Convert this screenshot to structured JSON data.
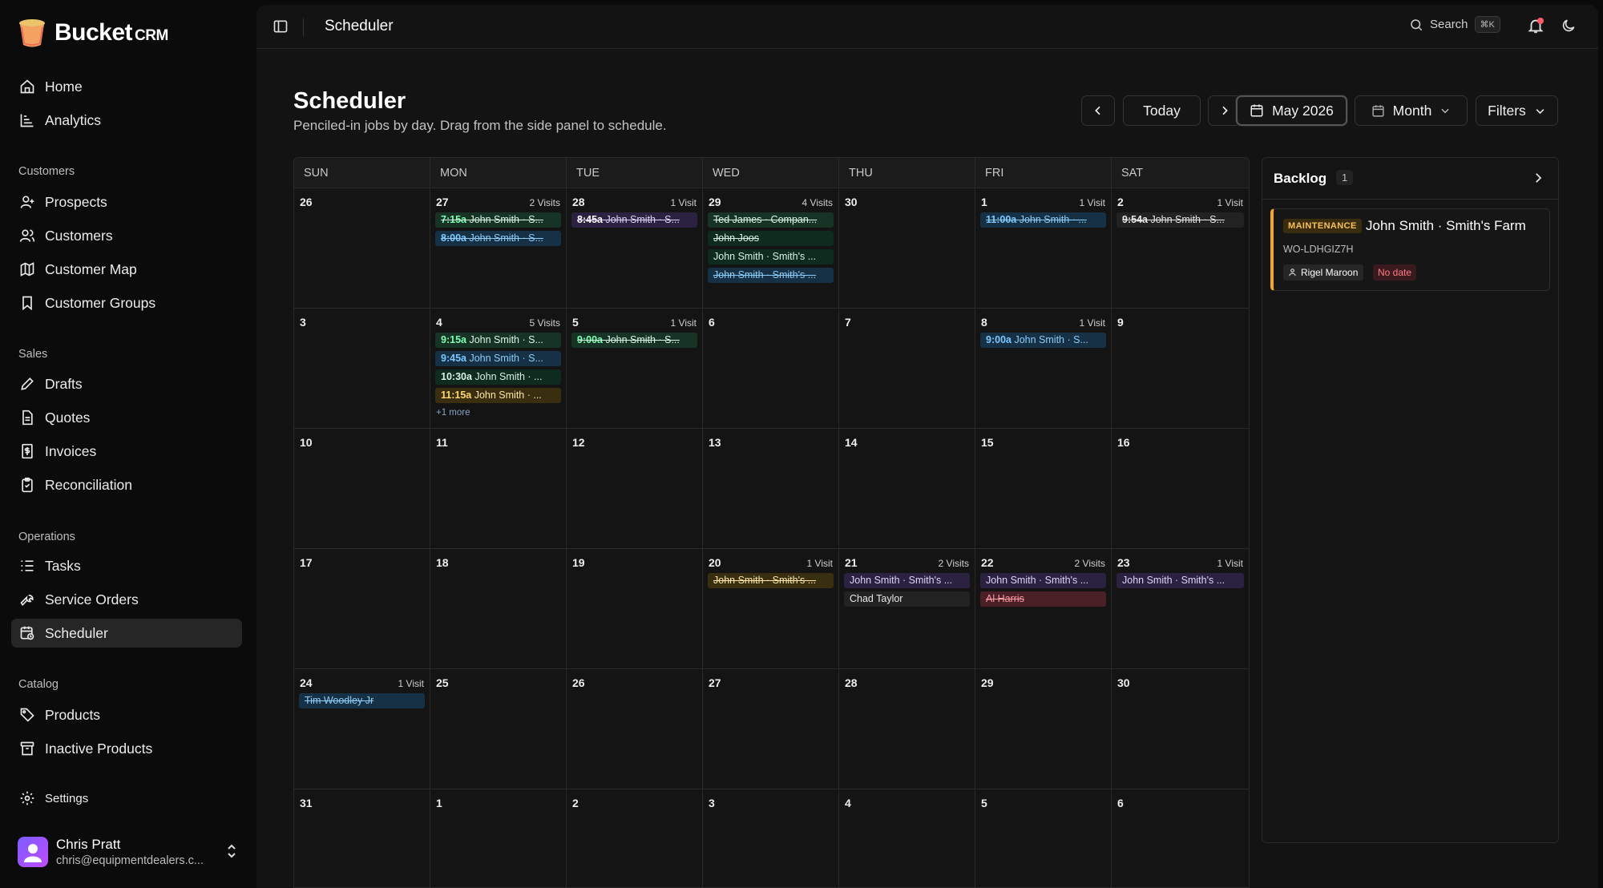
{
  "app": {
    "brand": "Bucket",
    "brand_suffix": "CRM"
  },
  "sidebar": {
    "items": [
      {
        "label": "Home",
        "icon": "home-icon"
      },
      {
        "label": "Analytics",
        "icon": "analytics-icon"
      }
    ],
    "sections": [
      {
        "title": "Customers",
        "items": [
          {
            "label": "Prospects",
            "icon": "user-plus-icon"
          },
          {
            "label": "Customers",
            "icon": "users-icon"
          },
          {
            "label": "Customer Map",
            "icon": "map-icon"
          },
          {
            "label": "Customer Groups",
            "icon": "bookmark-icon"
          }
        ]
      },
      {
        "title": "Sales",
        "items": [
          {
            "label": "Drafts",
            "icon": "pen-icon"
          },
          {
            "label": "Quotes",
            "icon": "document-icon"
          },
          {
            "label": "Invoices",
            "icon": "invoice-icon"
          },
          {
            "label": "Reconciliation",
            "icon": "clipboard-icon"
          }
        ]
      },
      {
        "title": "Operations",
        "items": [
          {
            "label": "Tasks",
            "icon": "list-icon"
          },
          {
            "label": "Service Orders",
            "icon": "wrench-icon"
          },
          {
            "label": "Scheduler",
            "icon": "calendar-clock-icon",
            "active": true
          }
        ]
      },
      {
        "title": "Catalog",
        "items": [
          {
            "label": "Products",
            "icon": "tag-icon"
          },
          {
            "label": "Inactive Products",
            "icon": "archive-icon"
          }
        ]
      }
    ],
    "settings": "Settings",
    "user": {
      "name": "Chris Pratt",
      "email": "chris@equipmentdealers.c..."
    }
  },
  "topbar": {
    "title": "Scheduler",
    "search_label": "Search",
    "search_shortcut": "⌘K"
  },
  "header": {
    "title": "Scheduler",
    "subtitle": "Penciled-in jobs by day. Drag from the side panel to schedule.",
    "today": "Today",
    "month_label": "May 2026",
    "view": "Month",
    "filters": "Filters"
  },
  "calendar": {
    "weekdays": [
      "SUN",
      "MON",
      "TUE",
      "WED",
      "THU",
      "FRI",
      "SAT"
    ],
    "weeks": [
      [
        {
          "day": "26"
        },
        {
          "day": "27",
          "visits": "2 Visits",
          "events": [
            {
              "time": "7:15a",
              "text": "John Smith · S...",
              "color": "green",
              "done": true
            },
            {
              "time": "8:00a",
              "text": "John Smith · S...",
              "color": "blue",
              "done": true
            }
          ]
        },
        {
          "day": "28",
          "visits": "1 Visit",
          "events": [
            {
              "time": "8:45a",
              "text": "John Smith · S...",
              "color": "purple",
              "done": true
            }
          ]
        },
        {
          "day": "29",
          "visits": "4 Visits",
          "events": [
            {
              "time": "",
              "text": "Ted James · Compan...",
              "color": "green",
              "done": true
            },
            {
              "time": "",
              "text": "John Joos",
              "color": "darkgreen",
              "done": true
            },
            {
              "time": "",
              "text": "John Smith · Smith's ...",
              "color": "darkgreen",
              "done": false
            },
            {
              "time": "",
              "text": "John Smith · Smith's ...",
              "color": "blue",
              "done": true
            }
          ]
        },
        {
          "day": "30"
        },
        {
          "day": "1",
          "visits": "1 Visit",
          "events": [
            {
              "time": "11:00a",
              "text": "John Smith · ...",
              "color": "blue",
              "done": true
            }
          ]
        },
        {
          "day": "2",
          "visits": "1 Visit",
          "events": [
            {
              "time": "9:54a",
              "text": "John Smith · S...",
              "color": "gray",
              "done": true
            }
          ]
        }
      ],
      [
        {
          "day": "3"
        },
        {
          "day": "4",
          "visits": "5 Visits",
          "more": "+1 more",
          "events": [
            {
              "time": "9:15a",
              "text": "John Smith · S...",
              "color": "green",
              "done": false
            },
            {
              "time": "9:45a",
              "text": "John Smith · S...",
              "color": "blue",
              "done": false
            },
            {
              "time": "10:30a",
              "text": "John Smith · ...",
              "color": "darkgreen",
              "done": false
            },
            {
              "time": "11:15a",
              "text": "John Smith · ...",
              "color": "yellow",
              "done": false
            }
          ]
        },
        {
          "day": "5",
          "visits": "1 Visit",
          "events": [
            {
              "time": "9:00a",
              "text": "John Smith · S...",
              "color": "green",
              "done": true
            }
          ]
        },
        {
          "day": "6"
        },
        {
          "day": "7"
        },
        {
          "day": "8",
          "visits": "1 Visit",
          "events": [
            {
              "time": "9:00a",
              "text": "John Smith · S...",
              "color": "blue",
              "done": false
            }
          ]
        },
        {
          "day": "9"
        }
      ],
      [
        {
          "day": "10"
        },
        {
          "day": "11"
        },
        {
          "day": "12"
        },
        {
          "day": "13"
        },
        {
          "day": "14"
        },
        {
          "day": "15"
        },
        {
          "day": "16"
        }
      ],
      [
        {
          "day": "17"
        },
        {
          "day": "18"
        },
        {
          "day": "19"
        },
        {
          "day": "20",
          "visits": "1 Visit",
          "events": [
            {
              "time": "",
              "text": "John Smith · Smith's ...",
              "color": "yellow",
              "done": true
            }
          ]
        },
        {
          "day": "21",
          "visits": "2 Visits",
          "events": [
            {
              "time": "",
              "text": "John Smith · Smith's ...",
              "color": "purple",
              "done": false
            },
            {
              "time": "",
              "text": "Chad Taylor",
              "color": "gray",
              "done": false
            }
          ]
        },
        {
          "day": "22",
          "visits": "2 Visits",
          "events": [
            {
              "time": "",
              "text": "John Smith · Smith's ...",
              "color": "purple",
              "done": false
            },
            {
              "time": "",
              "text": "Al Harris",
              "color": "red",
              "done": true
            }
          ]
        },
        {
          "day": "23",
          "visits": "1 Visit",
          "events": [
            {
              "time": "",
              "text": "John Smith · Smith's ...",
              "color": "purple",
              "done": false
            }
          ]
        }
      ],
      [
        {
          "day": "24",
          "visits": "1 Visit",
          "events": [
            {
              "time": "",
              "text": "Tim Woodley Jr",
              "color": "blue",
              "done": true
            }
          ]
        },
        {
          "day": "25"
        },
        {
          "day": "26"
        },
        {
          "day": "27"
        },
        {
          "day": "28"
        },
        {
          "day": "29"
        },
        {
          "day": "30"
        }
      ],
      [
        {
          "day": "31"
        },
        {
          "day": "1"
        },
        {
          "day": "2"
        },
        {
          "day": "3"
        },
        {
          "day": "4"
        },
        {
          "day": "5"
        },
        {
          "day": "6"
        }
      ]
    ]
  },
  "backlog": {
    "title": "Backlog",
    "count": "1",
    "card": {
      "tag": "MAINTENANCE",
      "title": "John Smith · Smith's Farm",
      "wo": "WO-LDHGIZ7H",
      "assignee": "Rigel Maroon",
      "status": "No date"
    }
  },
  "colors": {
    "accent_orange": "#f5a623",
    "event_green": "#163326",
    "event_blue": "#163045",
    "event_purple": "#2a2240",
    "event_yellow": "#3a2e10",
    "event_red": "#4a1f25"
  }
}
